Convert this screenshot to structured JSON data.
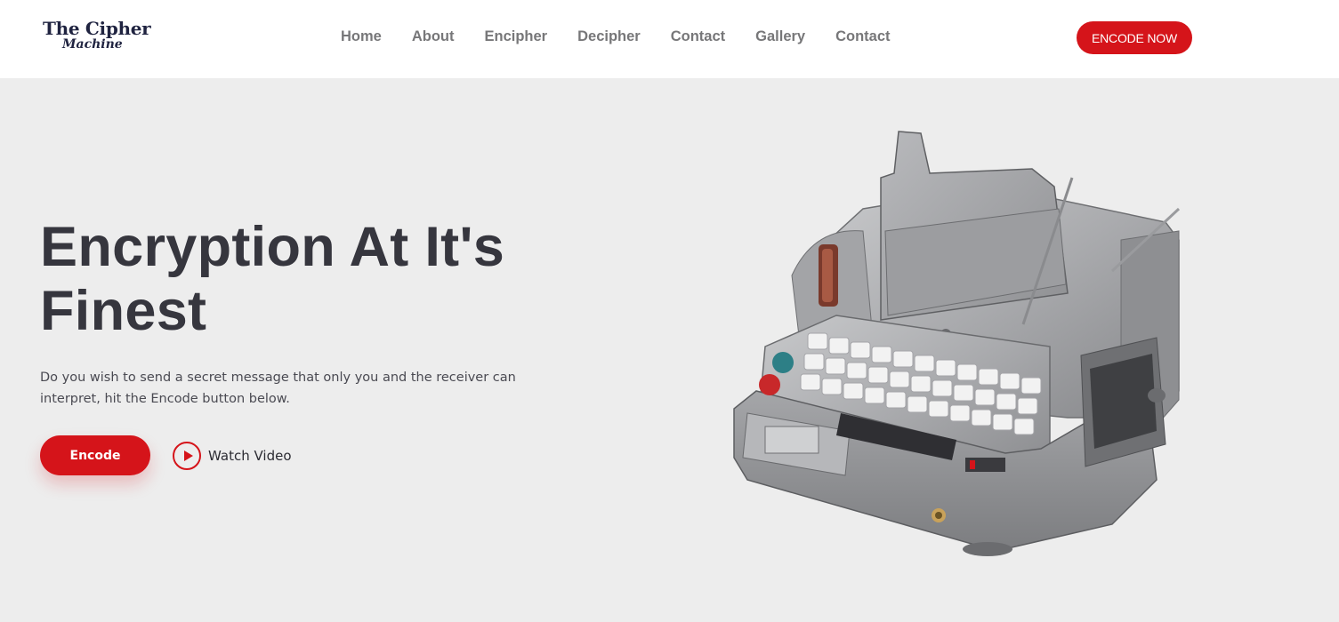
{
  "brand": {
    "line1": "The Cipher",
    "line2": "Machine"
  },
  "nav": {
    "items": [
      {
        "label": "Home"
      },
      {
        "label": "About"
      },
      {
        "label": "Encipher"
      },
      {
        "label": "Decipher"
      },
      {
        "label": "Contact"
      },
      {
        "label": "Gallery"
      },
      {
        "label": "Contact"
      }
    ]
  },
  "header": {
    "cta_label": "ENCODE NOW"
  },
  "hero": {
    "title_line1": "Encryption At It's",
    "title_line2": "Finest",
    "description": "Do you wish to send a secret message that only you and the receiver can interpret, hit the Encode button below.",
    "encode_label": "Encode",
    "watch_label": "Watch Video"
  },
  "colors": {
    "accent": "#d5141a",
    "background": "#ededed",
    "header_bg": "#ffffff",
    "title_text": "#36363e",
    "nav_text": "#777779",
    "brand_text": "#1f2340"
  },
  "icons": {
    "play": "play-icon"
  }
}
